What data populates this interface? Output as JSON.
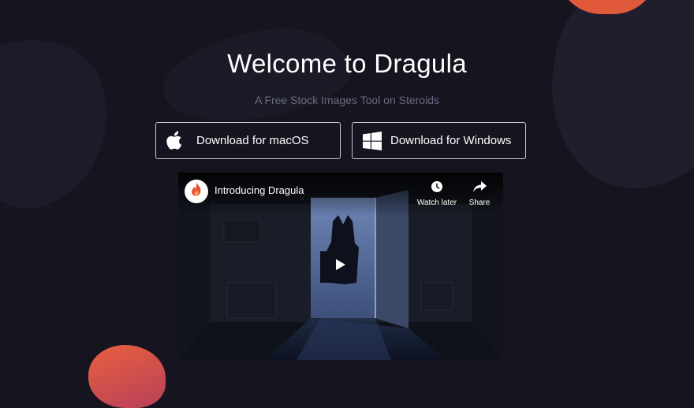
{
  "hero": {
    "title": "Welcome to Dragula",
    "subtitle": "A Free Stock Images Tool on Steroids"
  },
  "downloads": {
    "mac": {
      "label": "Download for macOS",
      "icon": "apple-icon"
    },
    "windows": {
      "label": "Download for Windows",
      "icon": "windows-icon"
    }
  },
  "video": {
    "title": "Introducing Dragula",
    "watch_later_label": "Watch later",
    "share_label": "Share",
    "channel_icon": "flame-icon",
    "play_icon": "play-icon"
  },
  "colors": {
    "background": "#15141f",
    "accent_orange": "#e1593b",
    "button_border": "#c9c9d4",
    "subtitle": "#6a6a80"
  }
}
